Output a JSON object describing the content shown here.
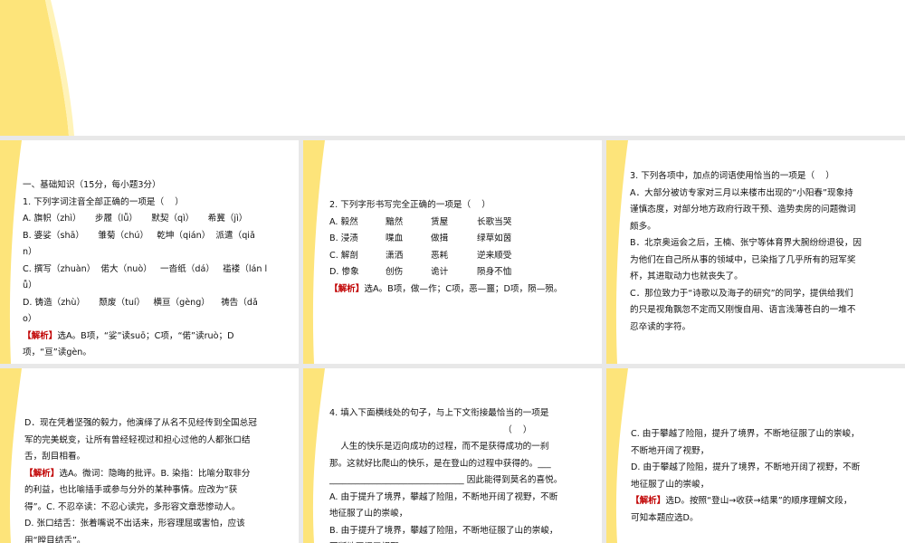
{
  "colors": {
    "swoosh": "#fde47a",
    "swoosh_light": "#fff3b8",
    "analysis_tag": "#c00000",
    "gap": "#e8e8e8"
  },
  "slides": [
    {
      "lines": []
    },
    {
      "lines": [
        {
          "text": "一、基础知识（15分，每小题3分）"
        },
        {
          "text": "1. 下列字词注音全部正确的一项是（    ）"
        },
        {
          "text": "A. 旗帜（zhì）     步履（lǚ）     默契（qì）     希冀（jì）"
        },
        {
          "text": "B. 婆娑（shā）     雏菊（chú）   乾坤（qián）  派遣（qiǎ"
        },
        {
          "text": "n）"
        },
        {
          "text": "C. 撰写（zhuàn）  偌大（nuò）   一沓纸（dá）   褴褛（lán l"
        },
        {
          "text": "ǚ）"
        },
        {
          "text": "D. 铸造（zhù）     颓废（tuí）   横亘（gèng）    祷告（dǎ"
        },
        {
          "text": "o）"
        },
        {
          "tag": "【解析】",
          "text": "选A。B项，“娑”读suō；C项，“偌”读ruò；D"
        },
        {
          "text": "项，“亘”读gèn。"
        }
      ]
    },
    {
      "lines": [
        {
          "text": "2. 下列字形书写完全正确的一项是（    ）"
        },
        {
          "cols": [
            "A. 毅然",
            "黯然",
            "赁屋",
            "长歌当哭"
          ]
        },
        {
          "cols": [
            "B. 浸渍",
            "喋血",
            "做揖",
            "绿草如茵"
          ]
        },
        {
          "cols": [
            "C. 解剖",
            "潇洒",
            "恶耗",
            "逆来顺受"
          ]
        },
        {
          "cols": [
            "D. 惨象",
            "创伤",
            "诡计",
            "陨身不恤"
          ]
        },
        {
          "tag": "【解析】",
          "text": "选A。B项，做—作；C项，恶—噩；D项，陨—殒。"
        }
      ]
    },
    {
      "lines": [
        {
          "text": "3. 下列各项中，加点的词语使用恰当的一项是（    ）"
        },
        {
          "text": "A．大部分被访专家对三月以来楼市出现的“小阳春”现象持"
        },
        {
          "text": "谨慎态度，对部分地方政府行政干预、造势卖房的问题微词"
        },
        {
          "text": "颇多。"
        },
        {
          "text": "B．北京奥运会之后，王楠、张宁等体育界大腕纷纷退役，因"
        },
        {
          "text": "为他们在自己所从事的领域中，已染指了几乎所有的冠军奖"
        },
        {
          "text": "杯，其进取动力也就丧失了。"
        },
        {
          "text": "C．那位致力于“诗歌以及海子的研究”的同学，提供给我们"
        },
        {
          "text": "的只是视角飘忽不定而又刚愎自用、语言浅薄苍白的一堆不"
        },
        {
          "text": "忍卒读的字符。"
        }
      ]
    },
    {
      "lines": [
        {
          "text": "D．现在凭着坚强的毅力，他演绎了从名不见经传到全国总冠"
        },
        {
          "text": "军的完美蜕变，让所有曾经轻视过和担心过他的人都张口结"
        },
        {
          "text": "舌，刮目相看。"
        },
        {
          "tag": "【解析】",
          "text": "选A。微词：隐晦的批评。B. 染指：比喻分取非分"
        },
        {
          "text": "的利益，也比喻插手或参与分外的某种事情。应改为“获"
        },
        {
          "text": "得”。C. 不忍卒读：不忍心读完，多形容文章悲惨动人。"
        },
        {
          "text": "D. 张口结舌：张着嘴说不出话来，形容理屈或害怕，应该"
        },
        {
          "text": "用“瞠目结舌”。"
        }
      ]
    },
    {
      "lines": [
        {
          "text": "4. 填入下面横线处的句子，与上下文衔接最恰当的一项是"
        },
        {
          "text": "                                                               （    ）"
        },
        {
          "text": "    人生的快乐是迈向成功的过程，而不是获得成功的一刹"
        },
        {
          "text": "那。这就好比爬山的快乐，是在登山的过程中获得的。___"
        },
        {
          "text": "_______________________________ 因此能得到莫名的喜悦。"
        },
        {
          "text": "A. 由于提升了境界，攀越了险阻，不断地开阔了视野，不断"
        },
        {
          "text": "地征服了山的崇峻，"
        },
        {
          "text": "B. 由于提升了境界，攀越了险阻，不断地征服了山的崇峻，"
        },
        {
          "text": "不断地开阔了视野，"
        }
      ]
    },
    {
      "lines": [
        {
          "text": "C. 由于攀越了险阻，提升了境界，不断地征服了山的崇峻，"
        },
        {
          "text": "不断地开阔了视野，"
        },
        {
          "text": "D. 由于攀越了险阻，提升了境界，不断地开阔了视野，不断"
        },
        {
          "text": "地征服了山的崇峻，"
        },
        {
          "tag": "【解析】",
          "text": "选D。按照“登山→收获→结果”的顺序理解文段，"
        },
        {
          "text": "可知本题应选D。"
        }
      ]
    }
  ]
}
